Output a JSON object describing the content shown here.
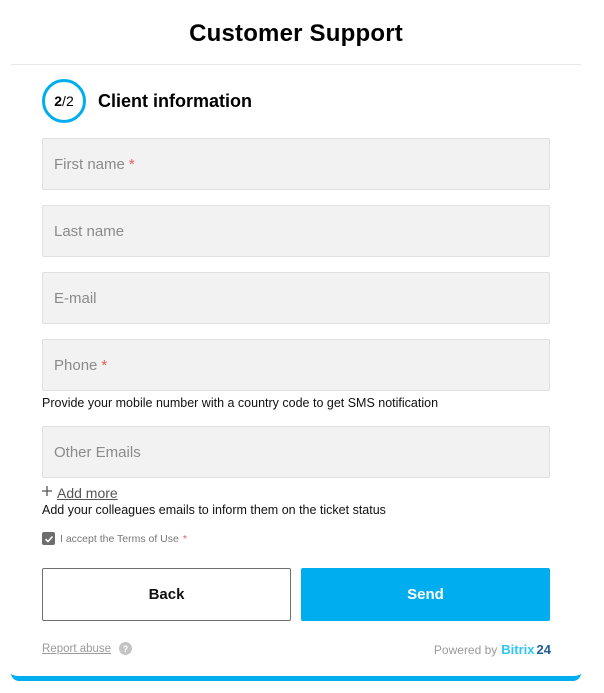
{
  "form": {
    "title": "Customer Support",
    "step": {
      "current": "2",
      "total": "2",
      "separator": "/",
      "title": "Client information"
    },
    "fields": {
      "first_name": {
        "placeholder": "First name",
        "required_mark": "*",
        "value": ""
      },
      "last_name": {
        "placeholder": "Last name",
        "value": ""
      },
      "email": {
        "placeholder": "E-mail",
        "value": ""
      },
      "phone": {
        "placeholder": "Phone",
        "required_mark": "*",
        "value": "",
        "hint": "Provide your mobile number with a country code to get SMS notification"
      },
      "other_emails": {
        "placeholder": "Other Emails",
        "value": "",
        "add_more_label": "Add more",
        "hint": "Add your colleagues emails to inform them on the ticket status"
      }
    },
    "consent": {
      "checked": true,
      "label": "I accept the Terms of Use",
      "required_mark": "*"
    },
    "buttons": {
      "back": "Back",
      "send": "Send"
    },
    "footer": {
      "report_abuse": "Report abuse",
      "help_icon_text": "?",
      "powered_by": "Powered by",
      "brand_part1": "Bitrix",
      "brand_part2": "24"
    }
  },
  "colors": {
    "accent": "#00aeef",
    "required": "#e85a5a",
    "field_bg": "#f2f2f2",
    "brand_light": "#2fc6f6",
    "brand_dark": "#215f98"
  },
  "icons": {
    "add": "plus-icon",
    "check": "check-icon",
    "help": "question-icon"
  }
}
